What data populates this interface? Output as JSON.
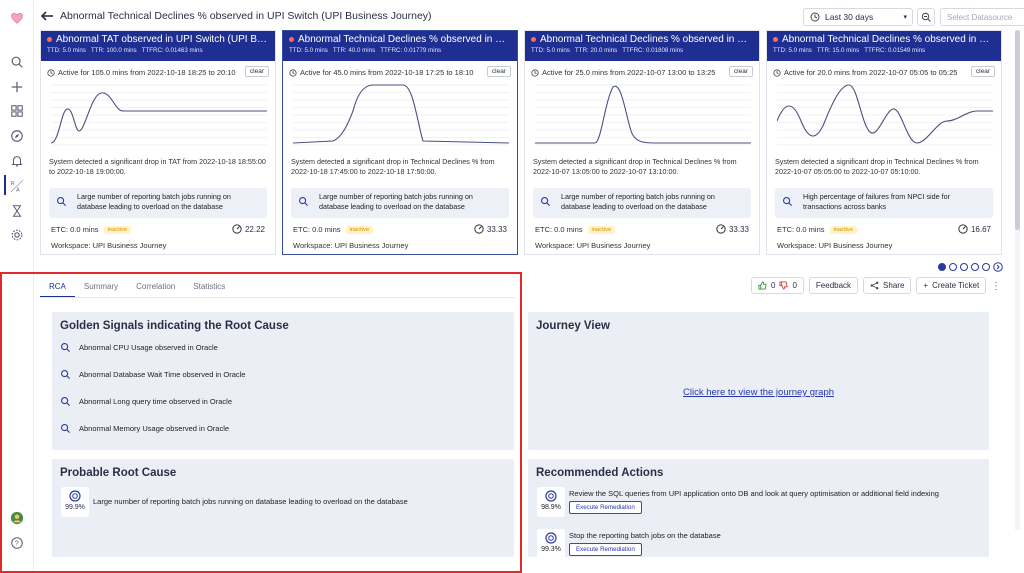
{
  "page": {
    "title": "Abnormal Technical Declines % observed in UPI Switch (UPI Business Journey)",
    "time_range": "Last 30 days",
    "datasource_placeholder": "Select Datasource"
  },
  "icons": {
    "sidebar": [
      "logo-icon",
      "search-icon",
      "plus-icon",
      "dashboard-icon",
      "compass-icon",
      "bell-icon",
      "rca-icon",
      "hourglass-icon",
      "gear-icon",
      "avatar-icon",
      "help-icon"
    ]
  },
  "cards": [
    {
      "title": "Abnormal TAT observed in UPI Switch (UPI Business Journey)",
      "ttd": "TTD: 5.0 mins",
      "ttr": "TTR: 100.0 mins",
      "ttfrc": "TTFRC: 0.01463 mins",
      "active": "Active for 105.0 mins from 2022-10-18 18:25 to 20:10",
      "clear": "clear",
      "detect": "System detected a significant drop in TAT from 2022-10-18 18:55:00 to 2022-10-18 19:00:00.",
      "reason": "Large number of reporting batch jobs running on database leading to overload on the database",
      "etc": "ETC:  0.0 mins",
      "status": "inactive",
      "score": "22.22",
      "workspace_label": "Workspace:",
      "workspace": "UPI Business Journey",
      "selected": false
    },
    {
      "title": "Abnormal Technical Declines % observed in UPI Switch (UPI Business Journey)",
      "ttd": "TTD: 5.0 mins",
      "ttr": "TTR: 40.0 mins",
      "ttfrc": "TTFRC: 0.01779 mins",
      "active": "Active for 45.0 mins from 2022-10-18 17:25 to 18:10",
      "clear": "clear",
      "detect": "System detected a significant drop in Technical Declines % from 2022-10-18 17:45:00 to 2022-10-18 17:50:00.",
      "reason": "Large number of reporting batch jobs running on database leading to overload on the database",
      "etc": "ETC:  0.0 mins",
      "status": "inactive",
      "score": "33.33",
      "workspace_label": "Workspace:",
      "workspace": "UPI Business Journey",
      "selected": true
    },
    {
      "title": "Abnormal Technical Declines % observed in UPI Switch (UPI Business Journey)",
      "ttd": "TTD: 5.0 mins",
      "ttr": "TTR: 20.0 mins",
      "ttfrc": "TTFRC: 0.01808 mins",
      "active": "Active for 25.0 mins from 2022-10-07 13:00 to 13:25",
      "clear": "clear",
      "detect": "System detected a significant drop in Technical Declines % from 2022-10-07 13:05:00 to 2022-10-07 13:10:00.",
      "reason": "Large number of reporting batch jobs running on database leading to overload on the database",
      "etc": "ETC:  0.0 mins",
      "status": "inactive",
      "score": "33.33",
      "workspace_label": "Workspace:",
      "workspace": "UPI Business Journey",
      "selected": false
    },
    {
      "title": "Abnormal Technical Declines % observed in UPI Switch (UPI Business Journey)",
      "ttd": "TTD: 5.0 mins",
      "ttr": "TTR: 15.0 mins",
      "ttfrc": "TTFRC: 0.01549 mins",
      "active": "Active for 20.0 mins from 2022-10-07 05:05 to 05:25",
      "clear": "clear",
      "detect": "System detected a significant drop in Technical Declines % from 2022-10-07 05:05:00 to 2022-10-07 05:10:00.",
      "reason": "High percentage of failures from NPCI side for transactions across banks",
      "etc": "ETC:  0.0 mins",
      "status": "inactive",
      "score": "16.67",
      "workspace_label": "Workspace:",
      "workspace": "UPI Business Journey",
      "selected": false
    }
  ],
  "pager": {
    "pages": 5,
    "current": 1
  },
  "tabs": [
    {
      "label": "RCA",
      "active": true
    },
    {
      "label": "Summary",
      "active": false
    },
    {
      "label": "Correlation",
      "active": false
    },
    {
      "label": "Statistics",
      "active": false
    }
  ],
  "actions": {
    "likes": "0",
    "dislikes": "0",
    "feedback": "Feedback",
    "share": "Share",
    "create_ticket": "Create Ticket"
  },
  "golden_signals": {
    "heading": "Golden Signals indicating the Root Cause",
    "items": [
      "Abnormal CPU Usage observed in Oracle",
      "Abnormal Database Wait Time observed in Oracle",
      "Abnormal Long query time observed in Oracle",
      "Abnormal Memory Usage observed in Oracle"
    ]
  },
  "probable_root_cause": {
    "heading": "Probable Root Cause",
    "confidence": "99.9%",
    "text": "Large number of reporting batch jobs running on database leading to overload on the database"
  },
  "journey_view": {
    "heading": "Journey View",
    "link": "Click here to view the journey graph"
  },
  "recommended_actions": {
    "heading": "Recommended Actions",
    "items": [
      {
        "confidence": "98.9%",
        "text": "Review the SQL queries from UPI application onto DB and look at query optimisation or additional field indexing",
        "button": "Execute Remediation"
      },
      {
        "confidence": "99.3%",
        "text": "Stop the reporting batch jobs on the database",
        "button": "Execute Remediation"
      }
    ]
  },
  "colors": {
    "header_blue": "#1f2f91",
    "alert_dot": "#ff6a5e",
    "highlight_red": "#e32a2a"
  }
}
